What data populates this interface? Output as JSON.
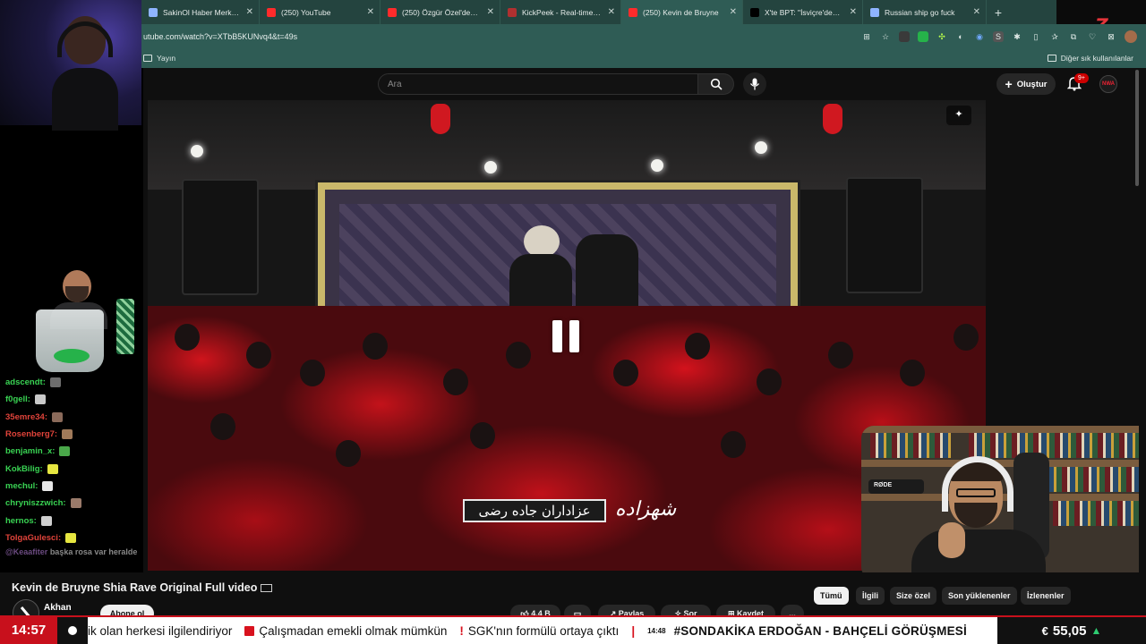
{
  "browser": {
    "tabs": [
      {
        "label": "SakinOl Haber Merkezi",
        "color": "#8fb4ff",
        "active": false
      },
      {
        "label": "(250) YouTube",
        "color": "#ff2b2b",
        "active": false
      },
      {
        "label": "(250) Özgür Özel'den, er geç",
        "color": "#ff2b2b",
        "active": false
      },
      {
        "label": "KickPeek - Real-time URL Ch",
        "color": "#b03030",
        "active": false
      },
      {
        "label": "(250) Kevin de Bruyne",
        "color": "#ff2b2b",
        "active": true
      },
      {
        "label": "X'te BPT: \"İsviçre'den arkad",
        "color": "#000000",
        "active": false
      },
      {
        "label": "Russian ship go fuck",
        "color": "#8fb4ff",
        "active": false
      }
    ],
    "new_tab_label": "+",
    "url": "utube.com/watch?v=XTbB5KUNvq4&t=49s",
    "bookmark_left": "Yayın",
    "bookmark_right": "Diğer sık kullanılanlar"
  },
  "stream": {
    "logo_letter": "Z",
    "chat": [
      {
        "user": "adscendt:",
        "color": "#39d353",
        "emote": "#6d6d6d"
      },
      {
        "user": "f0gell:",
        "color": "#39d353",
        "emote": "#c9c9c9"
      },
      {
        "user": "35emre34:",
        "color": "#e0433a",
        "emote": "#8a6a5a"
      },
      {
        "user": "Rosenberg7:",
        "color": "#e0433a",
        "emote": "#a07a5a"
      },
      {
        "user": "benjamin_x:",
        "color": "#39d353",
        "emote": "#4aa84a"
      },
      {
        "user": "KokBilig:",
        "color": "#39d353",
        "emote": "#e6e640"
      },
      {
        "user": "mechul:",
        "color": "#39d353",
        "emote": "#e8e8e8"
      },
      {
        "user": "chryniszzwich:",
        "color": "#39d353",
        "emote": "#9a7a6a"
      },
      {
        "user": "hernos:",
        "color": "#39d353",
        "emote": "#d0d0d0"
      },
      {
        "user": "TolgaGulesci:",
        "color": "#e0433a",
        "emote": "#e6e640"
      }
    ],
    "chat_last_user": "@Keaafiter",
    "chat_last_message": "başka rosa var heralde"
  },
  "youtube": {
    "search_placeholder": "Ara",
    "create_label": "Oluştur",
    "notif_badge": "9+",
    "avatar_text": "NWA",
    "video_caption_left": "عزاداران جاده رضی",
    "video_caption_right": "شهزاده",
    "corner_btn": "✦",
    "title": "Kevin de Bruyne Shia Rave Original Full video",
    "channel": "Akhan",
    "subscribe": "Abone ol",
    "likes": "4,4 B",
    "actions": [
      "Paylaş",
      "Sor",
      "Kaydet"
    ],
    "more": "...",
    "chips": [
      "Tümü",
      "İlgili",
      "Size özel",
      "Son yüklenenler",
      "İzlenenler"
    ],
    "webcam_mic_label": "RØDE"
  },
  "ticker": {
    "time": "14:57",
    "items": [
      {
        "type": "text",
        "text": "ik olan herkesi ilgilendiriyor"
      },
      {
        "type": "square",
        "text": "Çalışmadan emekli olmak mümkün"
      },
      {
        "type": "excl",
        "text": "SGK'nın formülü ortaya çıktı"
      },
      {
        "type": "sep",
        "text": "|"
      },
      {
        "type": "timed",
        "time": "14:48",
        "text": "#SONDAKİKA ERDOĞAN - BAHÇELİ GÖRÜŞMESİ"
      }
    ],
    "currency_symbol": "€",
    "currency_value": "55,05",
    "trend": "▲"
  }
}
